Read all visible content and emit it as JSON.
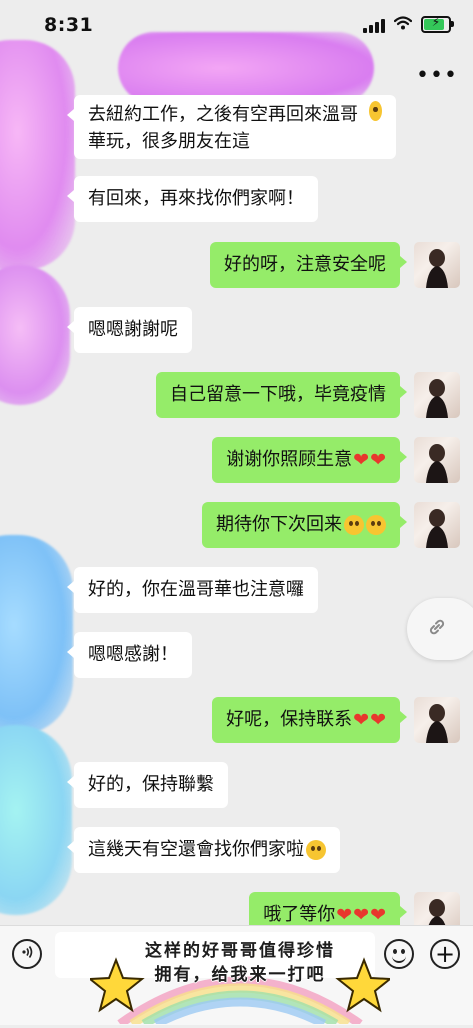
{
  "status": {
    "time": "8:31"
  },
  "header": {
    "more_label": "•••"
  },
  "messages": [
    {
      "side": "in",
      "text": "去紐約工作，之後有空再回來溫哥華玩，很多朋友在這",
      "emoji": "flushed-face"
    },
    {
      "side": "in",
      "text": "有回來，再來找你們家啊！"
    },
    {
      "side": "out",
      "text": "好的呀，注意安全呢"
    },
    {
      "side": "in",
      "text": "嗯嗯謝謝呢"
    },
    {
      "side": "out",
      "text": "自己留意一下哦，毕竟疫情"
    },
    {
      "side": "out",
      "text": "谢谢你照顾生意",
      "emoji": "two-hearts"
    },
    {
      "side": "out",
      "text": "期待你下次回来",
      "emoji": "two-flushed-faces"
    },
    {
      "side": "in",
      "text": "好的，你在溫哥華也注意囉"
    },
    {
      "side": "in",
      "text": "嗯嗯感謝！"
    },
    {
      "side": "out",
      "text": "好呢，保持联系",
      "emoji": "two-hearts"
    },
    {
      "side": "in",
      "text": "好的，保持聯繫"
    },
    {
      "side": "in",
      "text": "這幾天有空還會找你們家啦",
      "emoji": "grinning-face"
    },
    {
      "side": "out",
      "text": "哦了等你",
      "emoji": "three-hearts"
    }
  ],
  "sticker": {
    "line1": "这样的好哥哥值得珍惜",
    "line2": "拥有，给我来一打吧"
  },
  "icons": {
    "more": "more-icon",
    "link": "link-icon",
    "voice": "voice-icon",
    "emoji": "emoji-icon",
    "plus": "plus-icon"
  },
  "colors": {
    "outgoing_bubble": "#95ec69",
    "incoming_bubble": "#ffffff",
    "background": "#ededed"
  }
}
